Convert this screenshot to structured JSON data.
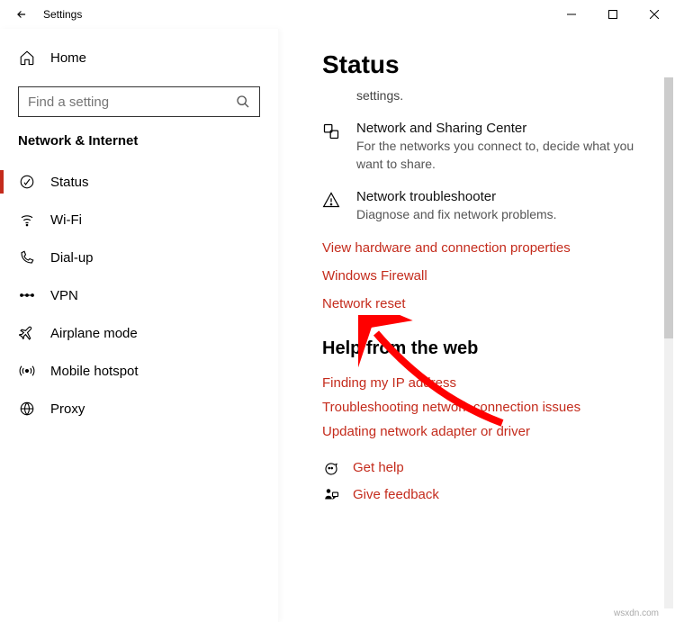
{
  "app_title": "Settings",
  "home_label": "Home",
  "search_placeholder": "Find a setting",
  "category": "Network & Internet",
  "nav": [
    {
      "label": "Status"
    },
    {
      "label": "Wi-Fi"
    },
    {
      "label": "Dial-up"
    },
    {
      "label": "VPN"
    },
    {
      "label": "Airplane mode"
    },
    {
      "label": "Mobile hotspot"
    },
    {
      "label": "Proxy"
    }
  ],
  "page_title": "Status",
  "snippet": "settings.",
  "options": [
    {
      "title": "Network and Sharing Center",
      "desc": "For the networks you connect to, decide what you want to share."
    },
    {
      "title": "Network troubleshooter",
      "desc": "Diagnose and fix network problems."
    }
  ],
  "links": [
    "View hardware and connection properties",
    "Windows Firewall",
    "Network reset"
  ],
  "help_section_title": "Help from the web",
  "help_links": [
    "Finding my IP address",
    "Troubleshooting network connection issues",
    "Updating network adapter or driver"
  ],
  "actions": [
    {
      "label": "Get help"
    },
    {
      "label": "Give feedback"
    }
  ],
  "watermark": "wsxdn.com"
}
